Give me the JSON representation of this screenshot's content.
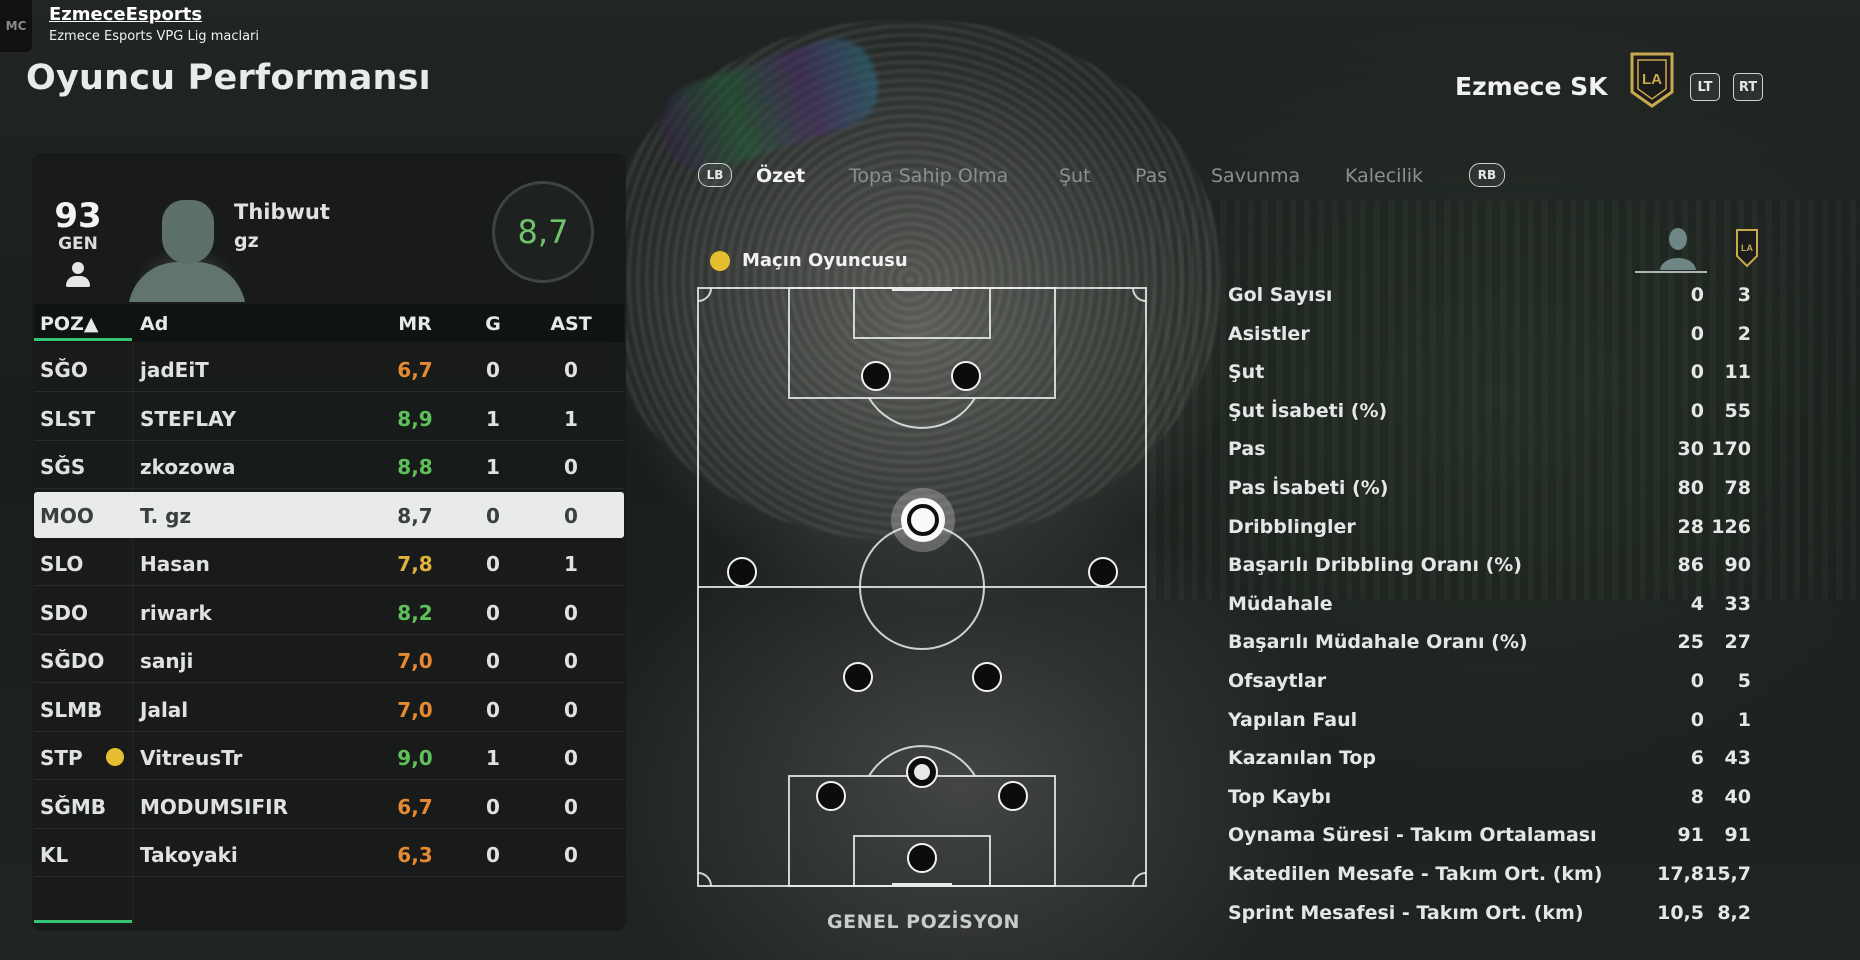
{
  "stream": {
    "channel_name": "EzmeceEsports",
    "subtitle": "Ezmece Esports VPG Lig maclari",
    "logo_text": "MC"
  },
  "page_title": "Oyuncu Performansı",
  "team": {
    "name": "Ezmece SK",
    "crest_text": "LA",
    "crest_color": "#c9a94f",
    "buttons": [
      "LT",
      "RT"
    ]
  },
  "player": {
    "overall": "93",
    "overall_label": "GEN",
    "name_line1": "Thibwut",
    "name_line2": "gz",
    "rating": "8,7"
  },
  "table": {
    "headers": [
      "POZ▲",
      "Ad",
      "MR",
      "G",
      "AST"
    ],
    "rows": [
      {
        "pos": "SĞO",
        "name": "jadEiT",
        "mr": "6,7",
        "g": "0",
        "ast": "0",
        "mr_color": "#e58a33"
      },
      {
        "pos": "SLST",
        "name": "STEFLAY",
        "mr": "8,9",
        "g": "1",
        "ast": "1",
        "mr_color": "#5fbf5a"
      },
      {
        "pos": "SĞS",
        "name": "zkozowa",
        "mr": "8,8",
        "g": "1",
        "ast": "0",
        "mr_color": "#5fbf5a"
      },
      {
        "pos": "MOO",
        "name": "T. gz",
        "mr": "8,7",
        "g": "0",
        "ast": "0",
        "mr_color": "#3b3f3d",
        "selected": true
      },
      {
        "pos": "SLO",
        "name": "Hasan",
        "mr": "7,8",
        "g": "0",
        "ast": "1",
        "mr_color": "#e0b23a"
      },
      {
        "pos": "SDO",
        "name": "riwark",
        "mr": "8,2",
        "g": "0",
        "ast": "0",
        "mr_color": "#5fbf5a"
      },
      {
        "pos": "SĞDO",
        "name": "sanji",
        "mr": "7,0",
        "g": "0",
        "ast": "0",
        "mr_color": "#e58a33"
      },
      {
        "pos": "SLMB",
        "name": "Jalal",
        "mr": "7,0",
        "g": "0",
        "ast": "0",
        "mr_color": "#e58a33"
      },
      {
        "pos": "STP",
        "name": "VitreusTr",
        "mr": "9,0",
        "g": "1",
        "ast": "0",
        "mr_color": "#5fbf5a",
        "motm": true
      },
      {
        "pos": "SĞMB",
        "name": "MODUMSIFIR",
        "mr": "6,7",
        "g": "0",
        "ast": "0",
        "mr_color": "#e58a33"
      },
      {
        "pos": "KL",
        "name": "Takoyaki",
        "mr": "6,3",
        "g": "0",
        "ast": "0",
        "mr_color": "#e58a33"
      }
    ]
  },
  "tabs": {
    "left_button": "LB",
    "right_button": "RB",
    "items": [
      "Özet",
      "Topa Sahip Olma",
      "Şut",
      "Pas",
      "Savunma",
      "Kalecilik"
    ],
    "active_index": 0
  },
  "pitch": {
    "motm_label": "Maçın Oyuncusu",
    "footer_label": "GENEL POZİSYON"
  },
  "stats": [
    {
      "label": "Gol Sayısı",
      "player": "0",
      "team": "3"
    },
    {
      "label": "Asistler",
      "player": "0",
      "team": "2"
    },
    {
      "label": "Şut",
      "player": "0",
      "team": "11"
    },
    {
      "label": "Şut İsabeti (%)",
      "player": "0",
      "team": "55"
    },
    {
      "label": "Pas",
      "player": "30",
      "team": "170"
    },
    {
      "label": "Pas İsabeti (%)",
      "player": "80",
      "team": "78"
    },
    {
      "label": "Dribblingler",
      "player": "28",
      "team": "126"
    },
    {
      "label": "Başarılı Dribbling Oranı (%)",
      "player": "86",
      "team": "90"
    },
    {
      "label": "Müdahale",
      "player": "4",
      "team": "33"
    },
    {
      "label": "Başarılı Müdahale Oranı (%)",
      "player": "25",
      "team": "27"
    },
    {
      "label": "Ofsaytlar",
      "player": "0",
      "team": "5"
    },
    {
      "label": "Yapılan Faul",
      "player": "0",
      "team": "1"
    },
    {
      "label": "Kazanılan Top",
      "player": "6",
      "team": "43"
    },
    {
      "label": "Top Kaybı",
      "player": "8",
      "team": "40"
    },
    {
      "label": "Oynama Süresi - Takım Ortalaması",
      "player": "91",
      "team": "91"
    },
    {
      "label": "Katedilen Mesafe - Takım Ort. (km)",
      "player": "17,8",
      "team": "15,7"
    },
    {
      "label": "Sprint Mesafesi - Takım Ort. (km)",
      "player": "10,5",
      "team": "8,2"
    }
  ],
  "colors": {
    "accent_green": "#37c276",
    "rating_green": "#6fc46a",
    "motm_gold": "#e5bf2f"
  }
}
